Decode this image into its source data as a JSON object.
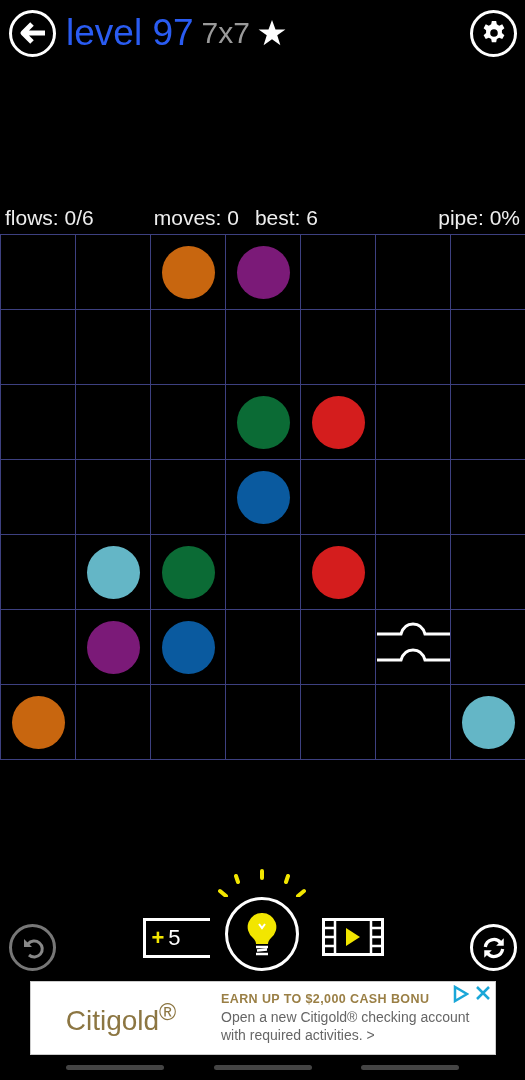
{
  "header": {
    "title": "level 97",
    "size": "7x7",
    "starred": true
  },
  "stats": {
    "flows": "flows: 0/6",
    "moves": "moves: 0",
    "best": "best: 6",
    "pipe": "pipe: 0%"
  },
  "grid": {
    "rows": [
      [
        {
          "kind": "empty"
        },
        {
          "kind": "empty"
        },
        {
          "kind": "dot",
          "color": "#c8660f"
        },
        {
          "kind": "dot",
          "color": "#7b1a78"
        },
        {
          "kind": "empty"
        },
        {
          "kind": "empty"
        },
        {
          "kind": "empty"
        }
      ],
      [
        {
          "kind": "empty"
        },
        {
          "kind": "empty"
        },
        {
          "kind": "empty"
        },
        {
          "kind": "empty"
        },
        {
          "kind": "empty"
        },
        {
          "kind": "empty"
        },
        {
          "kind": "empty"
        }
      ],
      [
        {
          "kind": "empty"
        },
        {
          "kind": "empty"
        },
        {
          "kind": "empty"
        },
        {
          "kind": "dot",
          "color": "#0b6b35"
        },
        {
          "kind": "dot",
          "color": "#d41d1d"
        },
        {
          "kind": "empty"
        },
        {
          "kind": "empty"
        }
      ],
      [
        {
          "kind": "empty"
        },
        {
          "kind": "empty"
        },
        {
          "kind": "empty"
        },
        {
          "kind": "dot",
          "color": "#0a5a9f"
        },
        {
          "kind": "empty"
        },
        {
          "kind": "empty"
        },
        {
          "kind": "empty"
        }
      ],
      [
        {
          "kind": "empty"
        },
        {
          "kind": "dot",
          "color": "#64b6c6"
        },
        {
          "kind": "dot",
          "color": "#0b6b35"
        },
        {
          "kind": "empty"
        },
        {
          "kind": "dot",
          "color": "#d41d1d"
        },
        {
          "kind": "empty"
        },
        {
          "kind": "empty"
        }
      ],
      [
        {
          "kind": "empty"
        },
        {
          "kind": "dot",
          "color": "#7b1a78"
        },
        {
          "kind": "dot",
          "color": "#0a5a9f"
        },
        {
          "kind": "empty"
        },
        {
          "kind": "empty"
        },
        {
          "kind": "bridge"
        },
        {
          "kind": "empty"
        }
      ],
      [
        {
          "kind": "dot",
          "color": "#c8660f"
        },
        {
          "kind": "empty"
        },
        {
          "kind": "empty"
        },
        {
          "kind": "empty"
        },
        {
          "kind": "empty"
        },
        {
          "kind": "empty"
        },
        {
          "kind": "dot",
          "color": "#64b6c6"
        }
      ]
    ]
  },
  "toolbar": {
    "hints": {
      "plus": "+",
      "count": "5"
    }
  },
  "ad": {
    "brand": "Citigold$^{®}$",
    "headline": "EARN UP TO $2,000 CASH BONU",
    "body": "Open a new Citigold® checking account with required activities. >"
  }
}
